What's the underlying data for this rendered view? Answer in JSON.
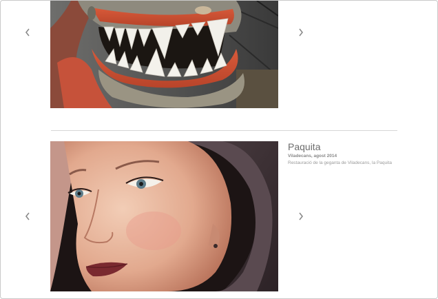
{
  "gallery": {
    "slides": [
      {
        "id": "top",
        "image_alt": "Dragon mouth with teeth",
        "prev_icon": "chevron-left-icon",
        "next_icon": "chevron-right-icon"
      },
      {
        "id": "bottom",
        "image_alt": "Giant figure face",
        "title": "Paquita",
        "meta": "Viladecans, agost 2014",
        "description": "Restauració de la geganta de Viladecans, la Paquita",
        "prev_icon": "chevron-left-icon",
        "next_icon": "chevron-right-icon"
      }
    ]
  },
  "colors": {
    "arrow": "#8a8a8a",
    "divider": "#d6d6d6",
    "title": "#6b6b6b"
  }
}
